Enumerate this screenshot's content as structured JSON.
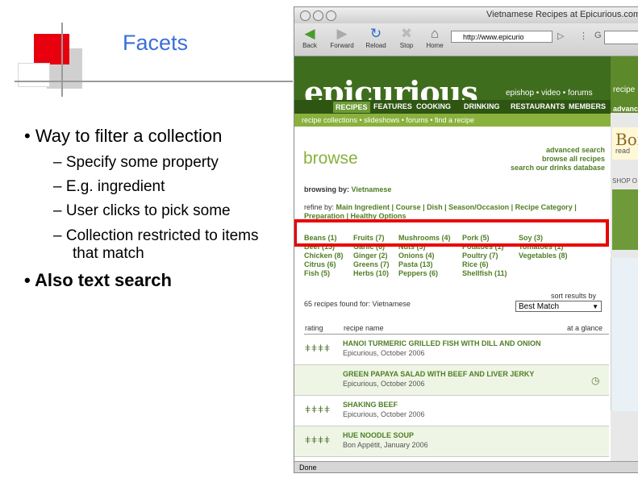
{
  "slide": {
    "title": "Facets",
    "bullet1": "• Way to filter a collection",
    "subbullets": [
      "–   Specify some property",
      "–   E.g. ingredient",
      "–   User clicks to pick some",
      "–   Collection restricted to items"
    ],
    "subbullet_cont": "that match",
    "bullet2": "• Also text search"
  },
  "browser": {
    "window_title": "Vietnamese Recipes at Epicurious.com",
    "toolbar": {
      "back": "Back",
      "forward": "Forward",
      "reload": "Reload",
      "stop": "Stop",
      "home": "Home"
    },
    "url": "http://www.epicurio",
    "status": "Done"
  },
  "site": {
    "logo": "epicurious",
    "epi_links": "epishop  •  video  •  forums",
    "side_recipe": "recipe",
    "nav": [
      "RECIPES",
      "FEATURES",
      "COOKING",
      "DRINKING",
      "RESTAURANTS",
      "MEMBERS"
    ],
    "nav_side": "advance",
    "subnav": "recipe collections  •  slideshows  •  forums  •  find a recipe",
    "browse": "browse",
    "adv_links": [
      "advanced search",
      "browse all recipes",
      "search our drinks database"
    ],
    "browsing_by_label": "browsing by:",
    "browsing_by_value": "Vietnamese",
    "refine_by_label": "refine by:",
    "refine_by_value": "Main Ingredient | Course | Dish | Season/Occasion | Recipe Category |",
    "refine_by_value2": "Preparation | Healthy Options",
    "facets": [
      [
        "Beans (1)",
        "Fruits (7)",
        "Mushrooms (4)",
        "Pork (5)",
        "Soy (3)"
      ],
      [
        "Beef (13)",
        "Garlic (6)",
        "Nuts (3)",
        "Potatoes (1)",
        "Tomatoes (1)"
      ],
      [
        "Chicken (8)",
        "Ginger (2)",
        "Onions (4)",
        "Poultry (7)",
        "Vegetables (8)"
      ],
      [
        "Citrus (6)",
        "Greens (7)",
        "Pasta (13)",
        "Rice (6)",
        ""
      ],
      [
        "Fish (5)",
        "Herbs (10)",
        "Peppers (6)",
        "Shellfish (11)",
        ""
      ]
    ],
    "results_count": "65 recipes found for: Vietnamese",
    "sort_label": "sort results by",
    "sort_value": "Best Match",
    "col_rating": "rating",
    "col_name": "recipe name",
    "col_glance": "at a glance",
    "recipes": [
      {
        "title": "HANOI TURMERIC GRILLED FISH WITH DILL AND ONION",
        "source": "Epicurious, October 2006",
        "rating": "ǂǂǂǂ"
      },
      {
        "title": "GREEN PAPAYA SALAD WITH BEEF AND LIVER JERKY",
        "source": "Epicurious, October 2006",
        "rating": ""
      },
      {
        "title": "SHAKING BEEF",
        "source": "Epicurious, October 2006",
        "rating": "ǂǂǂǂ"
      },
      {
        "title": "HUE NOODLE SOUP",
        "source": "Bon Appétit, January 2006",
        "rating": "ǂǂǂǂ"
      }
    ],
    "side_shop": "SHOP O",
    "side_read": "read",
    "side_bon": "Bon"
  },
  "colors": {
    "accent_blue": "#3a6fd8",
    "highlight_red": "#ea0000",
    "site_green": "#3f6d1e"
  }
}
